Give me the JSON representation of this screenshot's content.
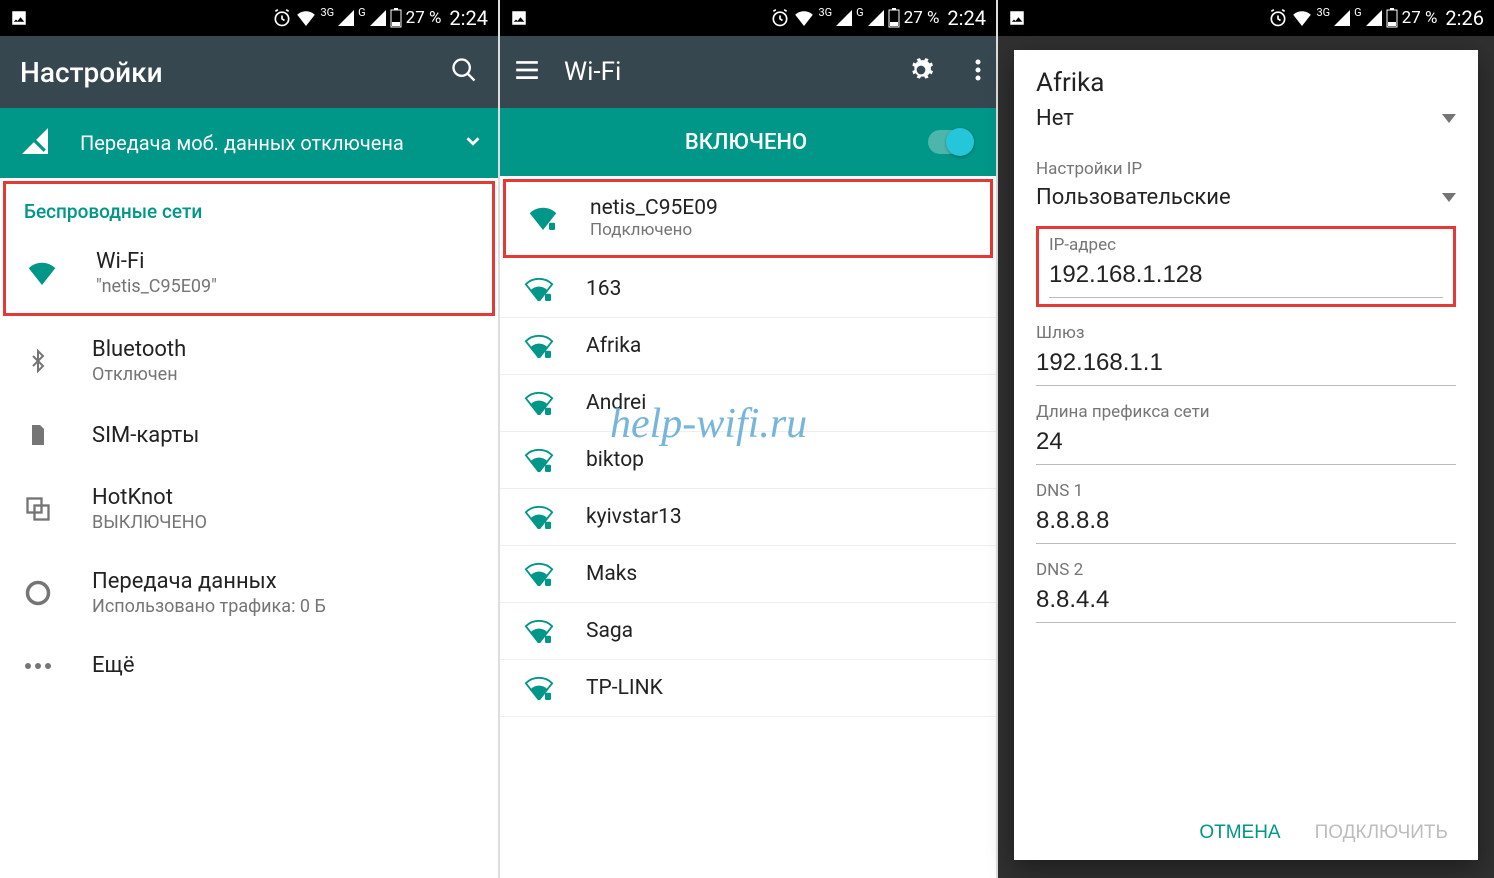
{
  "watermark": "help-wifi.ru",
  "status": {
    "net3g": "3G",
    "netG": "G",
    "battery_pct": "27 %",
    "time_a": "2:24",
    "time_c": "2:26"
  },
  "s1": {
    "title": "Настройки",
    "banner": "Передача моб. данных отключена",
    "section": "Беспроводные сети",
    "wifi_title": "Wi-Fi",
    "wifi_sub": "\"netis_C95E09\"",
    "bt_title": "Bluetooth",
    "bt_sub": "Отключен",
    "sim_title": "SIM-карты",
    "hotknot_title": "HotKnot",
    "hotknot_sub": "ВЫКЛЮЧЕНО",
    "data_title": "Передача данных",
    "data_sub": "Использовано трафика: 0 Б",
    "more": "Ещё"
  },
  "s2": {
    "title": "Wi-Fi",
    "enabled": "ВКЛЮЧЕНО",
    "nets": [
      {
        "name": "netis_C95E09",
        "sub": "Подключено",
        "strong": true
      },
      {
        "name": "163"
      },
      {
        "name": "Afrika"
      },
      {
        "name": "Andrei"
      },
      {
        "name": "biktop"
      },
      {
        "name": "kyivstar13"
      },
      {
        "name": "Maks"
      },
      {
        "name": "Saga"
      },
      {
        "name": "TP-LINK"
      }
    ]
  },
  "s3": {
    "title": "Afrika",
    "proxy_value": "Нет",
    "ip_settings_label": "Настройки IP",
    "ip_mode": "Пользовательские",
    "ip_label": "IP-адрес",
    "ip_value": "192.168.1.128",
    "gateway_label": "Шлюз",
    "gateway_value": "192.168.1.1",
    "prefix_label": "Длина префикса сети",
    "prefix_value": "24",
    "dns1_label": "DNS 1",
    "dns1_value": "8.8.8.8",
    "dns2_label": "DNS 2",
    "dns2_value": "8.8.4.4",
    "cancel": "ОТМЕНА",
    "connect": "ПОДКЛЮЧИТЬ"
  }
}
